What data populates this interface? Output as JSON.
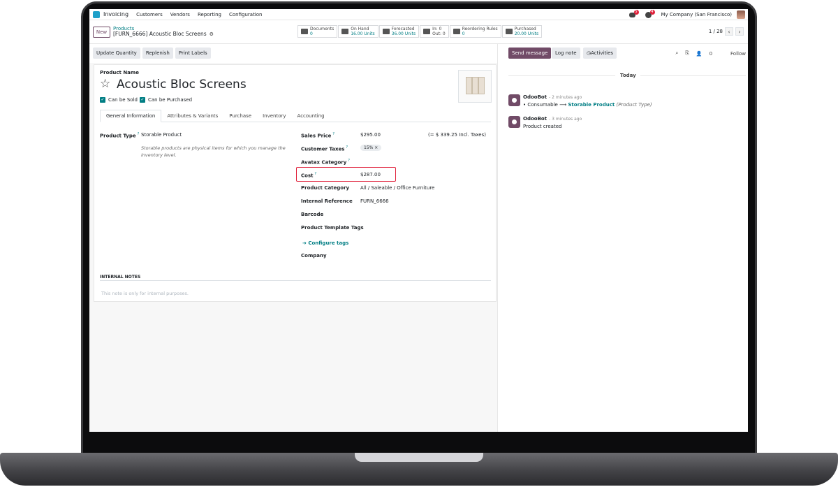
{
  "navbar": {
    "app_name": "Invoicing",
    "menu": [
      "Customers",
      "Vendors",
      "Reporting",
      "Configuration"
    ],
    "messages_badge": "5",
    "activities_badge": "4",
    "company": "My Company (San Francisco)"
  },
  "control": {
    "new_label": "New",
    "breadcrumb_parent": "Products",
    "breadcrumb_current": "[FURN_6666] Acoustic Bloc Screens",
    "pager": "1 / 28",
    "smart_buttons": [
      {
        "label": "Documents",
        "value": "0",
        "icon": "file-icon"
      },
      {
        "label": "On Hand",
        "value": "16.00 Units",
        "icon": "cubes-icon"
      },
      {
        "label": "Forecasted",
        "value": "36.00 Units",
        "icon": "chart-icon"
      },
      {
        "label": "In: 0",
        "value": "Out: 0",
        "icon": "exchange-icon"
      },
      {
        "label": "Reordering Rules",
        "value": "0",
        "icon": "refresh-icon"
      },
      {
        "label": "Purchased",
        "value": "20.00 Units",
        "icon": "credit-card-icon"
      }
    ]
  },
  "actions": [
    "Update Quantity",
    "Replenish",
    "Print Labels"
  ],
  "form": {
    "product_name_label": "Product Name",
    "product_name": "Acoustic Bloc Screens",
    "can_be_sold": "Can be Sold",
    "can_be_purchased": "Can be Purchased",
    "tabs": [
      "General Information",
      "Attributes & Variants",
      "Purchase",
      "Inventory",
      "Accounting"
    ],
    "product_type_label": "Product Type",
    "product_type": "Storable Product",
    "product_type_note": "Storable products are physical items for which you manage the inventory level.",
    "sales_price_label": "Sales Price",
    "sales_price": "$295.00",
    "sales_price_taxes": "(= $ 339.25 Incl. Taxes)",
    "customer_taxes_label": "Customer Taxes",
    "customer_taxes_tag": "15% ×",
    "avatax_label": "Avatax Category",
    "cost_label": "Cost",
    "cost": "$287.00",
    "category_label": "Product Category",
    "category": "All / Saleable / Office Furniture",
    "internal_ref_label": "Internal Reference",
    "internal_ref": "FURN_6666",
    "barcode_label": "Barcode",
    "template_tags_label": "Product Template Tags",
    "configure_tags": "Configure tags",
    "company_label": "Company",
    "help_mark": "?",
    "internal_notes_label": "INTERNAL NOTES",
    "internal_notes_placeholder": "This note is only for internal purposes."
  },
  "chatter": {
    "send_message": "Send message",
    "log_note": "Log note",
    "activities": "Activities",
    "followers_count": "0",
    "follow": "Follow",
    "today": "Today",
    "messages": [
      {
        "author": "OdooBot",
        "time": "- 2 minutes ago",
        "old_value": "Consumable",
        "new_value": "Storable Product",
        "field": "(Product Type)"
      },
      {
        "author": "OdooBot",
        "time": "- 3 minutes ago",
        "body": "Product created"
      }
    ]
  },
  "colors": {
    "brand": "#714b67",
    "accent": "#017e84",
    "highlight": "#e0213b"
  }
}
